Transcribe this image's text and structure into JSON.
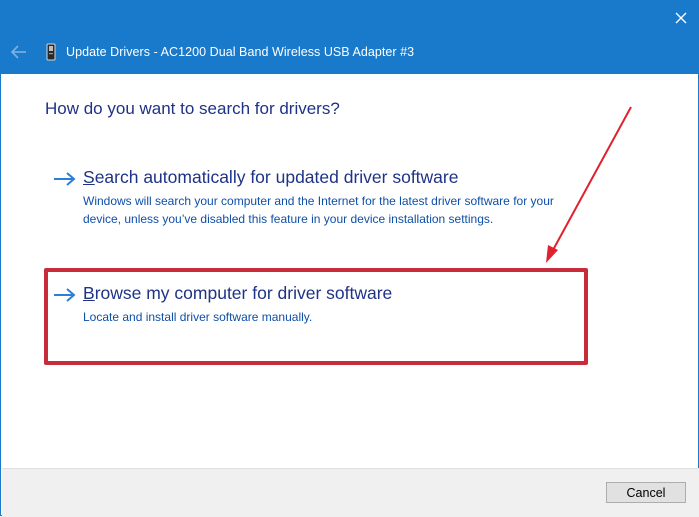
{
  "window": {
    "title": "Update Drivers - AC1200  Dual Band Wireless USB Adapter #3",
    "close_icon": "close-icon",
    "back_icon": "back-arrow-icon",
    "device_icon": "usb-adapter-icon"
  },
  "main": {
    "heading": "How do you want to search for drivers?",
    "options": [
      {
        "title_first_letter": "S",
        "title_rest": "earch automatically for updated driver software",
        "description": "Windows will search your computer and the Internet for the latest driver software for your device, unless you’ve disabled this feature in your device installation settings.",
        "icon": "right-arrow-icon"
      },
      {
        "title_first_letter": "B",
        "title_rest": "rowse my computer for driver software",
        "description": "Locate and install driver software manually.",
        "icon": "right-arrow-icon"
      }
    ]
  },
  "annotation": {
    "highlight_color": "#c62c3a",
    "arrow_color": "#e0212e"
  },
  "footer": {
    "cancel_label": "Cancel"
  },
  "colors": {
    "titlebar": "#1979ca",
    "heading_text": "#1e3287",
    "description_text": "#0f4fa8",
    "arrow": "#2b7fd6"
  }
}
